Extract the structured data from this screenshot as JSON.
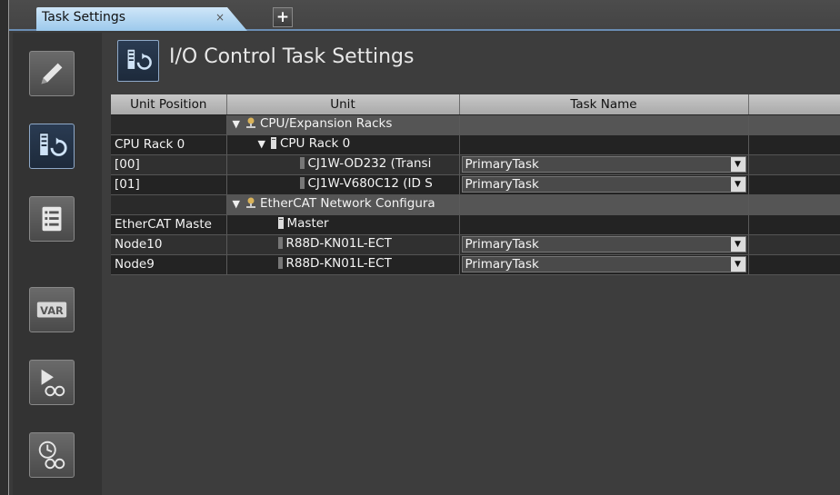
{
  "tab": {
    "label": "Task Settings",
    "close": "×",
    "add": "+"
  },
  "title": "I/O Control Task Settings",
  "sidebar": {
    "var_label": "VAR"
  },
  "table": {
    "columns": [
      "Unit Position",
      "Unit",
      "Task Name",
      ""
    ],
    "rows": [
      {
        "position": "",
        "unit": "CPU/Expansion Racks",
        "task": ""
      },
      {
        "position": "CPU Rack 0",
        "unit": "CPU Rack 0",
        "task": ""
      },
      {
        "position": "[00]",
        "unit": "CJ1W-OD232 (Transi",
        "task": "PrimaryTask"
      },
      {
        "position": "[01]",
        "unit": "CJ1W-V680C12 (ID S",
        "task": "PrimaryTask"
      },
      {
        "position": "",
        "unit": "EtherCAT Network Configura",
        "task": ""
      },
      {
        "position": "EtherCAT Maste",
        "unit": "Master",
        "task": ""
      },
      {
        "position": "Node10",
        "unit": "R88D-KN01L-ECT",
        "task": "PrimaryTask"
      },
      {
        "position": "Node9",
        "unit": "R88D-KN01L-ECT",
        "task": "PrimaryTask"
      }
    ]
  }
}
